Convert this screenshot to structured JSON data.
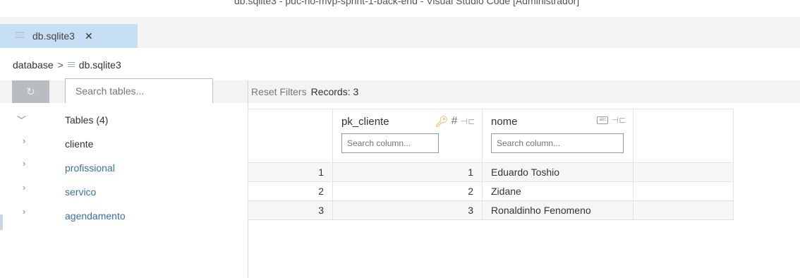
{
  "window": {
    "title": "db.sqlite3 - puc-rio-mvp-sprint-1-back-end - Visual Studio Code [Administrador]"
  },
  "editor_tab": {
    "label": "db.sqlite3",
    "close": "✕"
  },
  "breadcrumb": {
    "folder": "database",
    "separator": ">",
    "file": "db.sqlite3"
  },
  "sidebar": {
    "search_placeholder": "Search tables...",
    "refresh_icon": "refresh-icon",
    "tables_header": "Tables (4)",
    "items": [
      {
        "label": "cliente",
        "color": "#333333"
      },
      {
        "label": "profissional",
        "color": "#3c6fa1"
      },
      {
        "label": "servico",
        "color": "#3c6fa1"
      },
      {
        "label": "agendamento",
        "color": "#3c6fa1"
      }
    ]
  },
  "toolbar": {
    "reset_filters": "Reset Filters",
    "records": "Records: 3"
  },
  "grid": {
    "columns": [
      {
        "name": "pk_cliente",
        "icons": [
          "key-icon",
          "hash-icon",
          "pin-icon"
        ],
        "search_placeholder": "Search column..."
      },
      {
        "name": "nome",
        "icons": [
          "text-type-icon",
          "pin-icon"
        ],
        "search_placeholder": "Search column..."
      }
    ],
    "rows": [
      {
        "num": "1",
        "pk_cliente": "1",
        "nome": "Eduardo Toshio"
      },
      {
        "num": "2",
        "pk_cliente": "2",
        "nome": "Zidane"
      },
      {
        "num": "3",
        "pk_cliente": "3",
        "nome": "Ronaldinho Fenomeno"
      }
    ]
  }
}
